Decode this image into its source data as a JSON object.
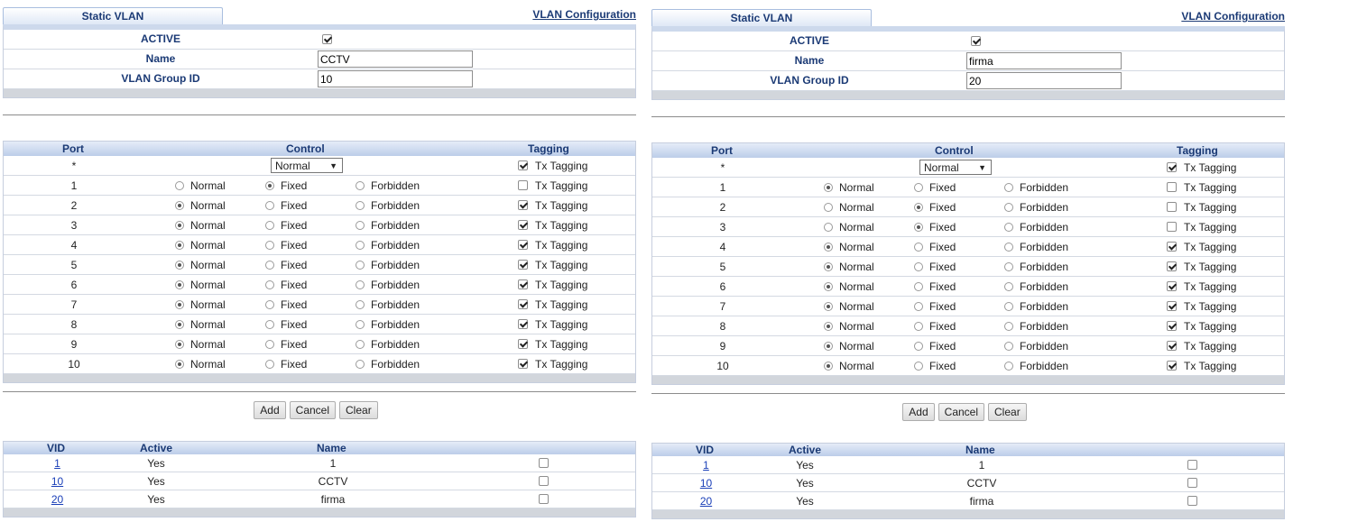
{
  "panels": [
    {
      "tab_label": "Static VLAN",
      "config_link": "VLAN Configuration",
      "active_label": "ACTIVE",
      "active_checked": true,
      "name_label": "Name",
      "name_value": "CCTV",
      "group_label": "VLAN Group ID",
      "group_value": "10",
      "headers": {
        "port": "Port",
        "control": "Control",
        "tagging": "Tagging"
      },
      "all_row": {
        "port": "*",
        "select_value": "Normal",
        "tx_checked": true,
        "tx_label": "Tx Tagging"
      },
      "ports": [
        {
          "port": "1",
          "control": "fixed",
          "tx": false
        },
        {
          "port": "2",
          "control": "normal",
          "tx": true
        },
        {
          "port": "3",
          "control": "normal",
          "tx": true
        },
        {
          "port": "4",
          "control": "normal",
          "tx": true
        },
        {
          "port": "5",
          "control": "normal",
          "tx": true
        },
        {
          "port": "6",
          "control": "normal",
          "tx": true
        },
        {
          "port": "7",
          "control": "normal",
          "tx": true
        },
        {
          "port": "8",
          "control": "normal",
          "tx": true
        },
        {
          "port": "9",
          "control": "normal",
          "tx": true
        },
        {
          "port": "10",
          "control": "normal",
          "tx": true
        }
      ],
      "radio_labels": {
        "normal": "Normal",
        "fixed": "Fixed",
        "forbidden": "Forbidden"
      },
      "tx_label": "Tx Tagging",
      "buttons": {
        "add": "Add",
        "cancel": "Cancel",
        "clear": "Clear"
      },
      "vid_headers": {
        "vid": "VID",
        "active": "Active",
        "name": "Name"
      },
      "vlans": [
        {
          "vid": "1",
          "active": "Yes",
          "name": "1"
        },
        {
          "vid": "10",
          "active": "Yes",
          "name": "CCTV"
        },
        {
          "vid": "20",
          "active": "Yes",
          "name": "firma"
        }
      ]
    },
    {
      "tab_label": "Static VLAN",
      "config_link": "VLAN Configuration",
      "active_label": "ACTIVE",
      "active_checked": true,
      "name_label": "Name",
      "name_value": "firma",
      "group_label": "VLAN Group ID",
      "group_value": "20",
      "headers": {
        "port": "Port",
        "control": "Control",
        "tagging": "Tagging"
      },
      "all_row": {
        "port": "*",
        "select_value": "Normal",
        "tx_checked": true,
        "tx_label": "Tx Tagging"
      },
      "ports": [
        {
          "port": "1",
          "control": "normal",
          "tx": false
        },
        {
          "port": "2",
          "control": "fixed",
          "tx": false
        },
        {
          "port": "3",
          "control": "fixed",
          "tx": false
        },
        {
          "port": "4",
          "control": "normal",
          "tx": true
        },
        {
          "port": "5",
          "control": "normal",
          "tx": true
        },
        {
          "port": "6",
          "control": "normal",
          "tx": true
        },
        {
          "port": "7",
          "control": "normal",
          "tx": true
        },
        {
          "port": "8",
          "control": "normal",
          "tx": true
        },
        {
          "port": "9",
          "control": "normal",
          "tx": true
        },
        {
          "port": "10",
          "control": "normal",
          "tx": true
        }
      ],
      "radio_labels": {
        "normal": "Normal",
        "fixed": "Fixed",
        "forbidden": "Forbidden"
      },
      "tx_label": "Tx Tagging",
      "buttons": {
        "add": "Add",
        "cancel": "Cancel",
        "clear": "Clear"
      },
      "vid_headers": {
        "vid": "VID",
        "active": "Active",
        "name": "Name"
      },
      "vlans": [
        {
          "vid": "1",
          "active": "Yes",
          "name": "1"
        },
        {
          "vid": "10",
          "active": "Yes",
          "name": "CCTV"
        },
        {
          "vid": "20",
          "active": "Yes",
          "name": "firma"
        }
      ]
    }
  ]
}
